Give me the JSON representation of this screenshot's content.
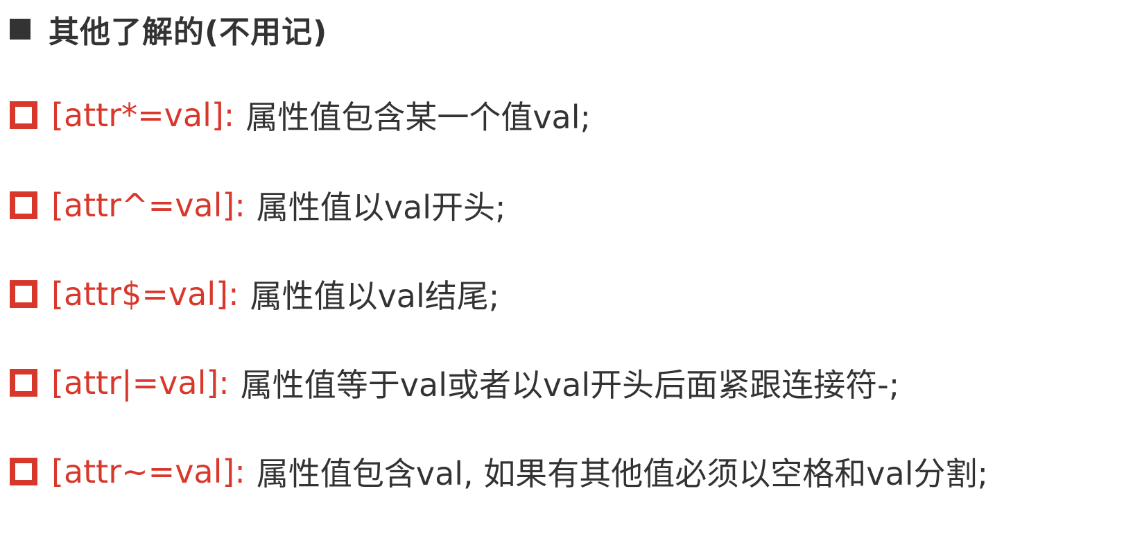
{
  "heading": {
    "text": "其他了解的(不用记)"
  },
  "items": [
    {
      "selector": "[attr*=val]:",
      "description": "属性值包含某一个值val;"
    },
    {
      "selector": "[attr^=val]:",
      "description": "属性值以val开头;"
    },
    {
      "selector": "[attr$=val]:",
      "description": "属性值以val结尾;"
    },
    {
      "selector": "[attr|=val]:",
      "description": "属性值等于val或者以val开头后面紧跟连接符-;"
    },
    {
      "selector": "[attr~=val]:",
      "description": "属性值包含val, 如果有其他值必须以空格和val分割;"
    }
  ],
  "colors": {
    "accent": "#d8382b",
    "text": "#333333",
    "background": "#ffffff"
  },
  "icons": {
    "heading_bullet": "filled-square-icon",
    "item_bullet": "hollow-square-icon"
  }
}
